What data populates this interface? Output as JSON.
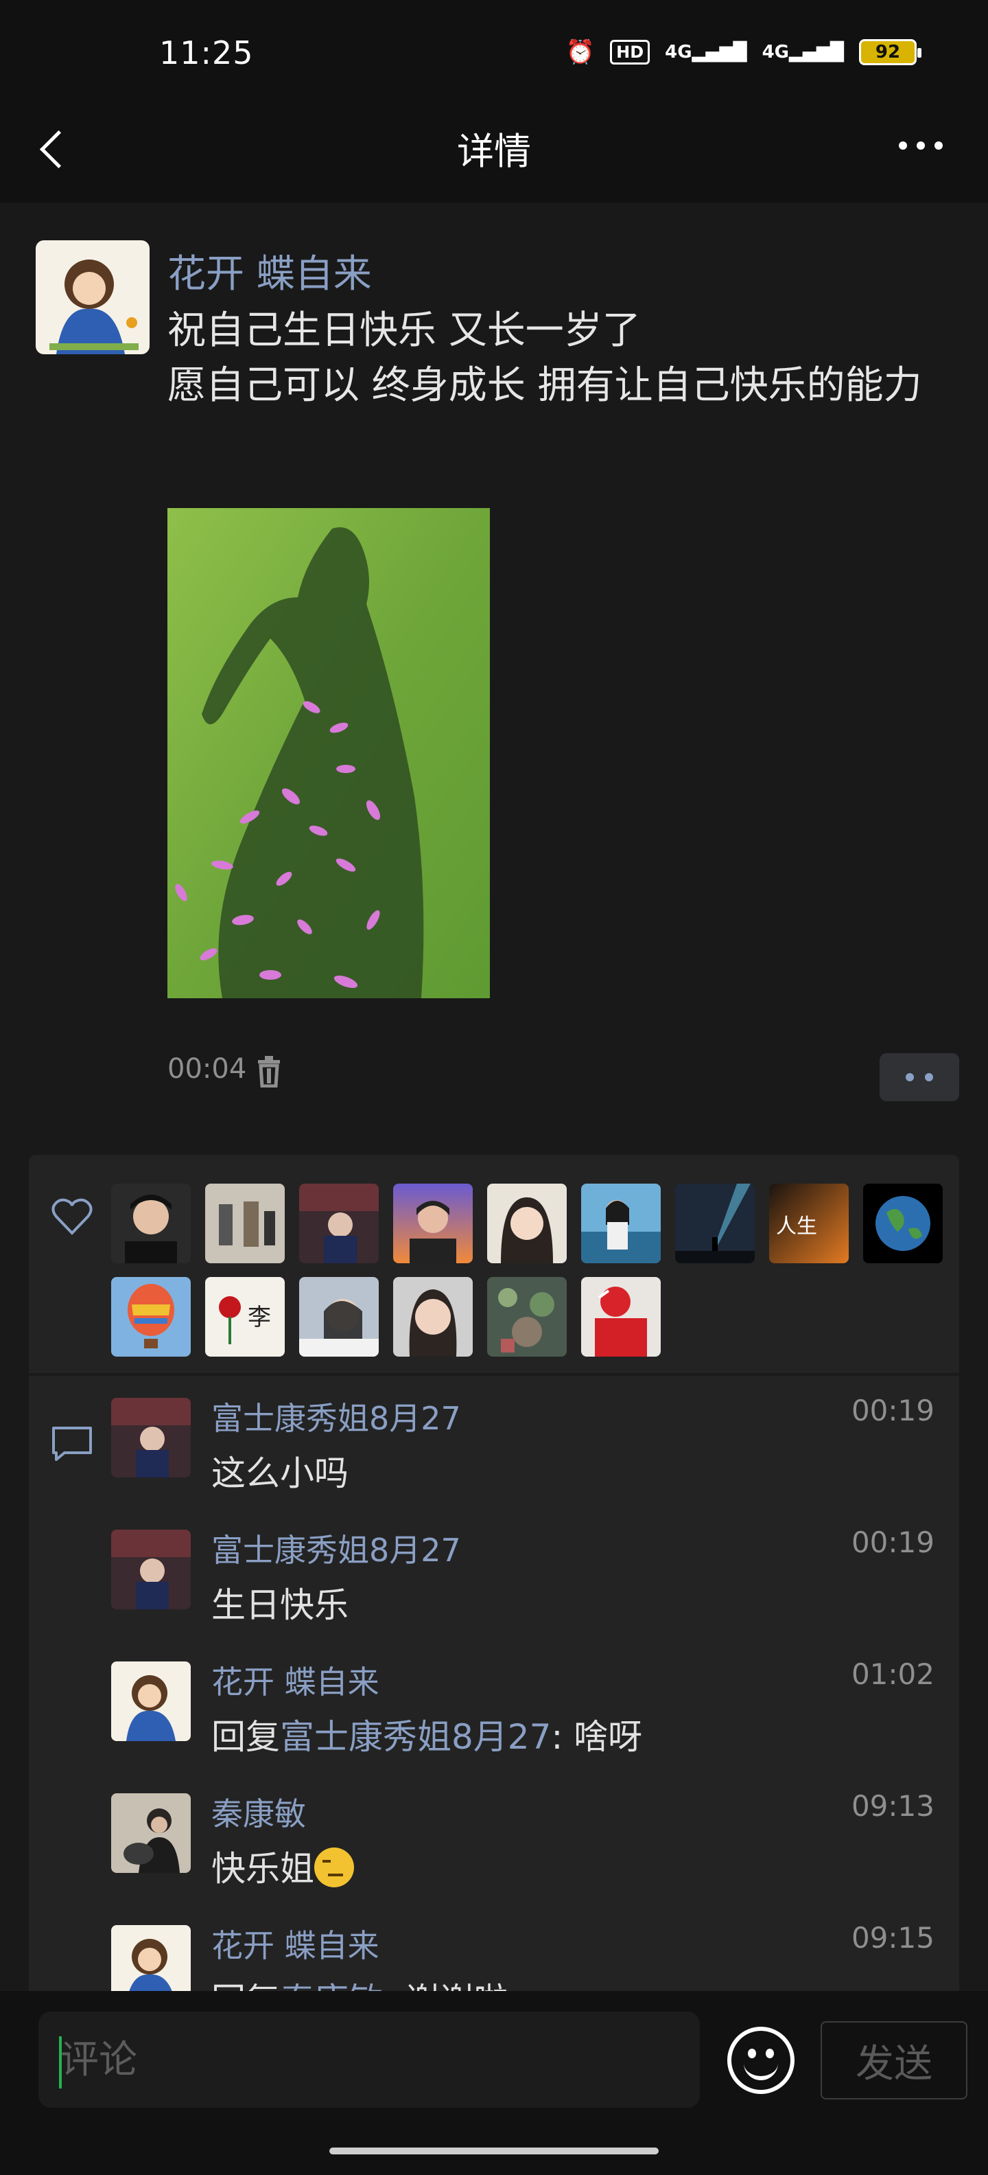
{
  "status_bar": {
    "time": "11:25",
    "alarm_icon": "alarm-icon",
    "hd_label": "HD",
    "network_1": "4G",
    "network_2": "4G",
    "battery": "92"
  },
  "nav": {
    "title": "详情",
    "back_icon": "chevron-left-icon",
    "more_icon": "more-dots-icon"
  },
  "post": {
    "author": "花开 蝶自来",
    "text_line1": "祝自己生日快乐 又长一岁了",
    "text_line2": "愿自己可以 终身成长 拥有让自己快乐的能力",
    "timestamp": "00:04",
    "delete_icon": "trash-icon"
  },
  "likes": {
    "icon": "heart-outline-icon",
    "avatars": [
      "avatar-1",
      "avatar-2",
      "avatar-3",
      "avatar-4",
      "avatar-5",
      "avatar-6",
      "avatar-7",
      "avatar-8",
      "avatar-9",
      "avatar-10",
      "avatar-11",
      "avatar-12",
      "avatar-13",
      "avatar-14",
      "avatar-15"
    ]
  },
  "comments": {
    "icon": "comment-bubble-icon",
    "items": [
      {
        "name": "富士康秀姐8月27",
        "time": "00:19",
        "text": "这么小吗"
      },
      {
        "name": "富士康秀姐8月27",
        "time": "00:19",
        "text": "生日快乐"
      },
      {
        "name": "花开 蝶自来",
        "time": "01:02",
        "reply_prefix": "回复",
        "reply_to": "富士康秀姐8月27",
        "text": ": 啥呀"
      },
      {
        "name": "秦康敏",
        "time": "09:13",
        "text": "快乐姐"
      },
      {
        "name": "花开 蝶自来",
        "time": "09:15",
        "reply_prefix": "回复",
        "reply_to": "秦康敏",
        "text": ": 谢谢啦"
      }
    ]
  },
  "input_bar": {
    "placeholder": "评论",
    "emoji_icon": "smiley-icon",
    "send_label": "发送"
  },
  "colors": {
    "background": "#191919",
    "bar": "#111111",
    "panel": "#232323",
    "name_blue": "#8a9fc4"
  }
}
